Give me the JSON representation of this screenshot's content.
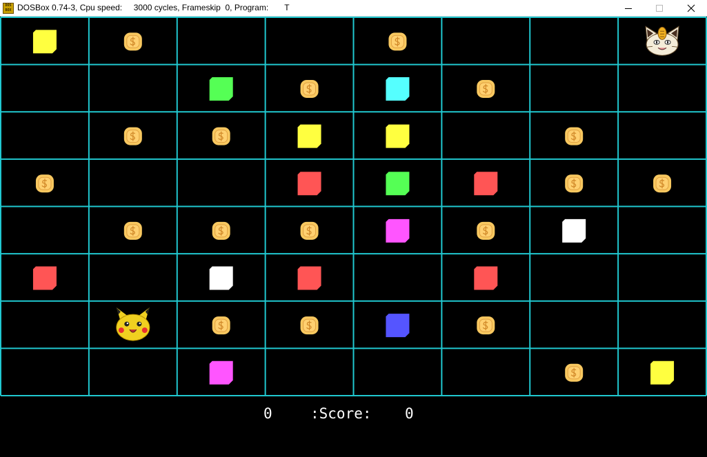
{
  "window": {
    "title": "DOSBox 0.74-3, Cpu speed:     3000 cycles, Frameskip  0, Program:       T",
    "icon": "dosbox-icon",
    "icon_text": "DOS BOX",
    "buttons": [
      "minimize-icon",
      "maximize-icon",
      "close-icon"
    ]
  },
  "colors": {
    "grid": "#20c8d0",
    "yellow": "#ffff40",
    "green": "#55ff55",
    "cyan": "#55ffff",
    "red": "#ff5555",
    "magenta": "#ff55ff",
    "white": "#ffffff",
    "blue": "#5555ff",
    "coin": "#f8c860"
  },
  "board": {
    "cols": 8,
    "rows": 8,
    "cells": [
      [
        "block:yellow",
        "coin",
        "",
        "",
        "coin",
        "",
        "",
        "meowth"
      ],
      [
        "",
        "",
        "block:green",
        "coin",
        "block:cyan",
        "coin",
        "",
        ""
      ],
      [
        "",
        "coin",
        "coin",
        "block:yellow",
        "block:yellow",
        "",
        "coin",
        ""
      ],
      [
        "coin",
        "",
        "",
        "block:red",
        "block:green",
        "block:red",
        "coin",
        "coin"
      ],
      [
        "",
        "coin",
        "coin",
        "coin",
        "block:magenta",
        "coin",
        "block:white",
        ""
      ],
      [
        "block:red",
        "",
        "block:white",
        "block:red",
        "",
        "block:red",
        "",
        ""
      ],
      [
        "",
        "pikachu",
        "coin",
        "coin",
        "block:blue",
        "coin",
        "",
        ""
      ],
      [
        "",
        "",
        "block:magenta",
        "",
        "",
        "",
        "coin",
        "block:yellow"
      ]
    ]
  },
  "score": {
    "left_value": "0",
    "label": ":Score:",
    "right_value": "0"
  }
}
